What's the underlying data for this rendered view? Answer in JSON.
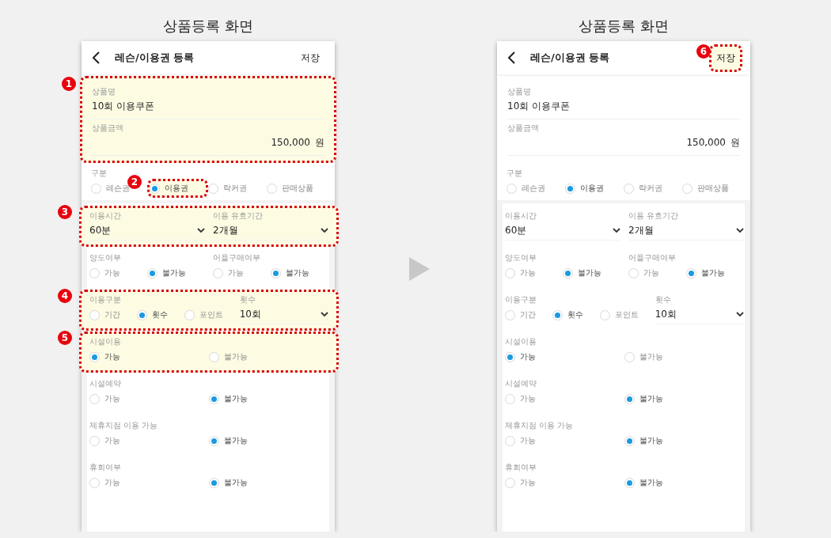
{
  "panels": [
    {
      "caption": "상품등록 화면",
      "screen": {
        "header": {
          "title": "레슨/이용권 등록",
          "action": {
            "label": "저장"
          }
        },
        "product": {
          "callout": "1",
          "fields": [
            {
              "kind": "text",
              "label": "상품명",
              "value": "10회 이용쿠폰"
            },
            {
              "kind": "amount",
              "label": "상품금액",
              "value": "150,000",
              "unit": "원"
            }
          ]
        },
        "category": {
          "label": "구분",
          "options": [
            {
              "label": "레슨권",
              "selected": false
            },
            {
              "label": "이용권",
              "selected": true,
              "callout": "2"
            },
            {
              "label": "락커권",
              "selected": false
            },
            {
              "label": "판매상품",
              "selected": false
            }
          ]
        },
        "rows": [
          {
            "callout": "3",
            "fields": [
              {
                "kind": "dropdown",
                "label": "이용시간",
                "value": "60분"
              },
              {
                "kind": "dropdown",
                "label": "이용 유효기간",
                "value": "2개월"
              }
            ]
          },
          {
            "fields": [
              {
                "kind": "radio",
                "label": "양도여부",
                "options": [
                  {
                    "label": "가능",
                    "selected": false
                  },
                  {
                    "label": "불가능",
                    "selected": true
                  }
                ]
              },
              {
                "kind": "radio",
                "label": "어플구매여부",
                "options": [
                  {
                    "label": "가능",
                    "selected": false
                  },
                  {
                    "label": "불가능",
                    "selected": true
                  }
                ]
              }
            ]
          },
          {
            "callout": "4",
            "fields": [
              {
                "kind": "radio",
                "label": "이용구분",
                "options": [
                  {
                    "label": "기간",
                    "selected": false
                  },
                  {
                    "label": "횟수",
                    "selected": true
                  },
                  {
                    "label": "포인트",
                    "selected": false
                  }
                ]
              },
              {
                "kind": "dropdown",
                "label": "횟수",
                "value": "10회"
              }
            ]
          },
          {
            "callout": "5",
            "fields": [
              {
                "kind": "radio",
                "label": "시설이용",
                "options": [
                  {
                    "label": "가능",
                    "selected": true
                  },
                  {
                    "label": "불가능",
                    "selected": false
                  }
                ]
              }
            ]
          },
          {
            "fields": [
              {
                "kind": "radio",
                "label": "시설예약",
                "options": [
                  {
                    "label": "가능",
                    "selected": false
                  },
                  {
                    "label": "불가능",
                    "selected": true
                  }
                ]
              }
            ]
          },
          {
            "fields": [
              {
                "kind": "radio",
                "label": "제휴지점 이용 가능",
                "options": [
                  {
                    "label": "가능",
                    "selected": false
                  },
                  {
                    "label": "불가능",
                    "selected": true
                  }
                ]
              }
            ]
          },
          {
            "fields": [
              {
                "kind": "radio",
                "label": "휴회여부",
                "options": [
                  {
                    "label": "가능",
                    "selected": false
                  },
                  {
                    "label": "불가능",
                    "selected": true
                  }
                ]
              }
            ]
          }
        ]
      }
    },
    {
      "caption": "상품등록 화면",
      "screen": {
        "header": {
          "title": "레슨/이용권 등록",
          "action": {
            "label": "저장",
            "callout": "6"
          }
        },
        "product": {
          "fields": [
            {
              "kind": "text",
              "label": "상품명",
              "value": "10회 이용쿠폰"
            },
            {
              "kind": "amount",
              "label": "상품금액",
              "value": "150,000",
              "unit": "원"
            }
          ]
        },
        "category": {
          "label": "구분",
          "options": [
            {
              "label": "레슨권",
              "selected": false
            },
            {
              "label": "이용권",
              "selected": true
            },
            {
              "label": "락커권",
              "selected": false
            },
            {
              "label": "판매상품",
              "selected": false
            }
          ]
        },
        "rows": [
          {
            "fields": [
              {
                "kind": "dropdown",
                "label": "이용시간",
                "value": "60분"
              },
              {
                "kind": "dropdown",
                "label": "이용 유효기간",
                "value": "2개월"
              }
            ]
          },
          {
            "fields": [
              {
                "kind": "radio",
                "label": "양도여부",
                "options": [
                  {
                    "label": "가능",
                    "selected": false
                  },
                  {
                    "label": "불가능",
                    "selected": true
                  }
                ]
              },
              {
                "kind": "radio",
                "label": "어플구매여부",
                "options": [
                  {
                    "label": "가능",
                    "selected": false
                  },
                  {
                    "label": "불가능",
                    "selected": true
                  }
                ]
              }
            ]
          },
          {
            "fields": [
              {
                "kind": "radio",
                "label": "이용구분",
                "options": [
                  {
                    "label": "기간",
                    "selected": false
                  },
                  {
                    "label": "횟수",
                    "selected": true
                  },
                  {
                    "label": "포인트",
                    "selected": false
                  }
                ]
              },
              {
                "kind": "dropdown",
                "label": "횟수",
                "value": "10회"
              }
            ]
          },
          {
            "fields": [
              {
                "kind": "radio",
                "label": "시설이용",
                "options": [
                  {
                    "label": "가능",
                    "selected": true
                  },
                  {
                    "label": "불가능",
                    "selected": false
                  }
                ]
              }
            ]
          },
          {
            "fields": [
              {
                "kind": "radio",
                "label": "시설예약",
                "options": [
                  {
                    "label": "가능",
                    "selected": false
                  },
                  {
                    "label": "불가능",
                    "selected": true
                  }
                ]
              }
            ]
          },
          {
            "fields": [
              {
                "kind": "radio",
                "label": "제휴지점 이용 가능",
                "options": [
                  {
                    "label": "가능",
                    "selected": false
                  },
                  {
                    "label": "불가능",
                    "selected": true
                  }
                ]
              }
            ]
          },
          {
            "fields": [
              {
                "kind": "radio",
                "label": "휴회여부",
                "options": [
                  {
                    "label": "가능",
                    "selected": false
                  },
                  {
                    "label": "불가능",
                    "selected": true
                  }
                ]
              }
            ]
          }
        ]
      }
    }
  ]
}
